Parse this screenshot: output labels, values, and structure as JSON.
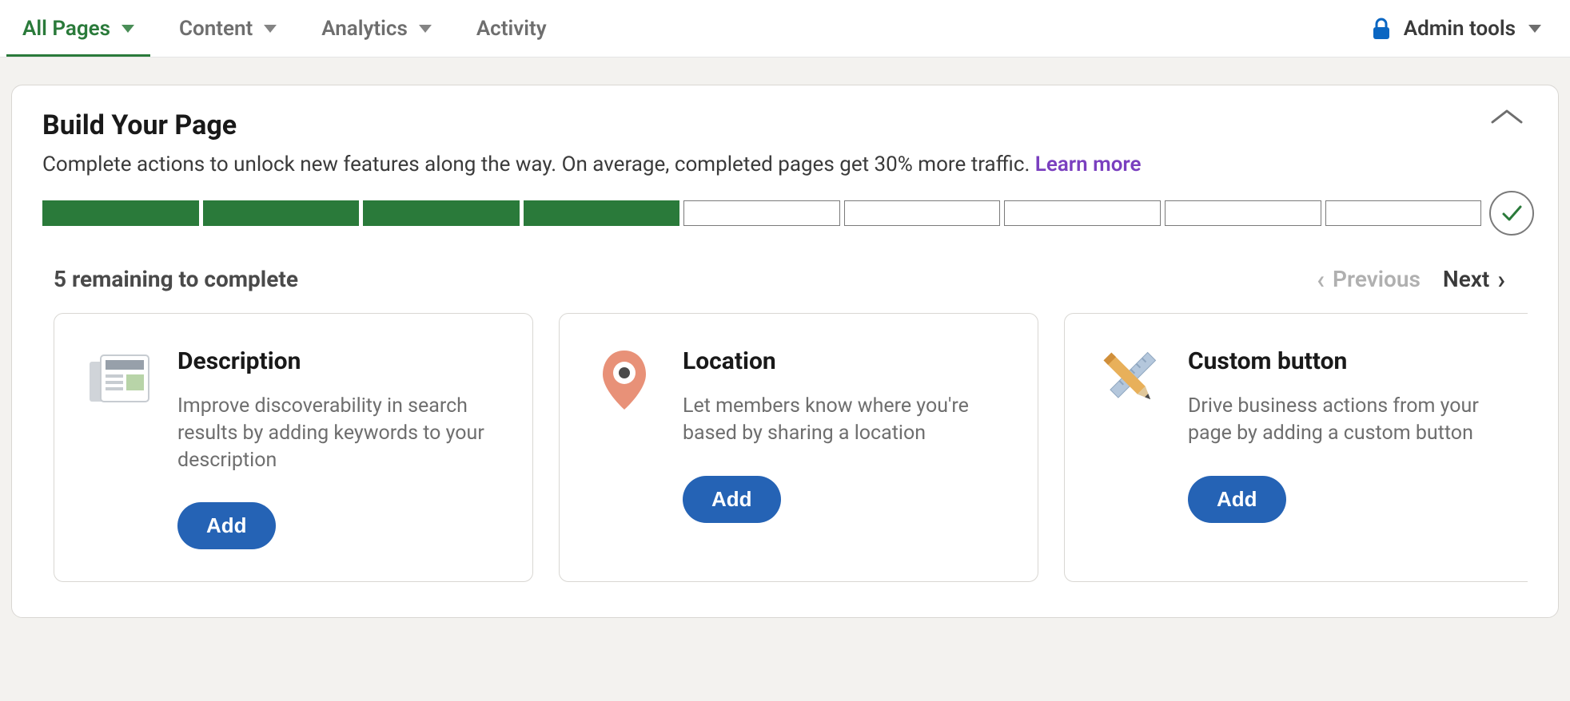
{
  "nav": {
    "items": [
      {
        "label": "All Pages",
        "active": true,
        "caret": true
      },
      {
        "label": "Content",
        "active": false,
        "caret": true
      },
      {
        "label": "Analytics",
        "active": false,
        "caret": true
      },
      {
        "label": "Activity",
        "active": false,
        "caret": false
      }
    ],
    "admin_label": "Admin tools"
  },
  "panel": {
    "title": "Build Your Page",
    "subtitle": "Complete actions to unlock new features along the way. On average, completed pages get 30% more traffic. ",
    "learn_more": "Learn more",
    "progress": {
      "done": 4,
      "total": 9
    },
    "remaining_text": "5 remaining to complete",
    "prev_label": "Previous",
    "next_label": "Next"
  },
  "cards": [
    {
      "icon": "description-icon",
      "title": "Description",
      "desc": "Improve discoverability in search results by adding keywords to your description",
      "button": "Add"
    },
    {
      "icon": "location-pin-icon",
      "title": "Location",
      "desc": "Let members know where you're based by sharing a location",
      "button": "Add"
    },
    {
      "icon": "pencil-ruler-icon",
      "title": "Custom button",
      "desc": "Drive business actions from your page by adding a custom button",
      "button": "Add"
    }
  ],
  "colors": {
    "accent_green": "#2a7a3a",
    "link_purple": "#7a3fbf",
    "primary_blue": "#2563b5"
  }
}
